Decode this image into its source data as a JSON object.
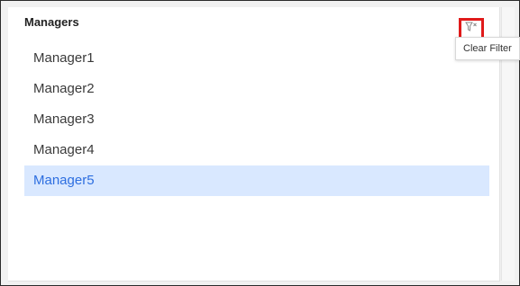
{
  "panel": {
    "title": "Managers"
  },
  "filter": {
    "icon": "filter-clear-icon",
    "highlight_color": "#e01a1a",
    "tooltip": "Clear Filter"
  },
  "managers": {
    "items": [
      {
        "label": "Manager1",
        "selected": false
      },
      {
        "label": "Manager2",
        "selected": false
      },
      {
        "label": "Manager3",
        "selected": false
      },
      {
        "label": "Manager4",
        "selected": false
      },
      {
        "label": "Manager5",
        "selected": true
      }
    ],
    "selected_bg": "#d9e8ff",
    "selected_text": "#2d6ee0"
  }
}
